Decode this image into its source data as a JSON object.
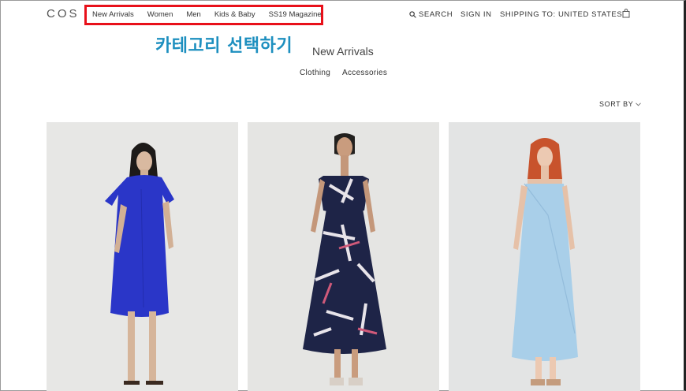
{
  "brand": {
    "logo": "COS"
  },
  "nav": {
    "items": [
      {
        "label": "New Arrivals"
      },
      {
        "label": "Women"
      },
      {
        "label": "Men"
      },
      {
        "label": "Kids & Baby"
      },
      {
        "label": "SS19 Magazine"
      }
    ],
    "highlight_color": "#e8101a"
  },
  "utility": {
    "search_label": "SEARCH",
    "signin_label": "SIGN IN",
    "shipping_label": "SHIPPING TO:  UNITED STATES",
    "bag_icon": "shopping-bag-icon"
  },
  "annotation": {
    "text": "카테고리 선택하기",
    "color": "#1d8fbf"
  },
  "page": {
    "title": "New Arrivals"
  },
  "subnav": {
    "items": [
      {
        "label": "Clothing"
      },
      {
        "label": "Accessories"
      }
    ]
  },
  "sort": {
    "label": "SORT BY"
  },
  "products": [
    {
      "image": "model-blue-tshirt-dress",
      "dress_color": "#2a36c8"
    },
    {
      "image": "model-navy-print-pinafore-dress",
      "dress_color": "#1e2447"
    },
    {
      "image": "model-light-blue-slip-dress",
      "dress_color": "#a9cfe9"
    }
  ]
}
